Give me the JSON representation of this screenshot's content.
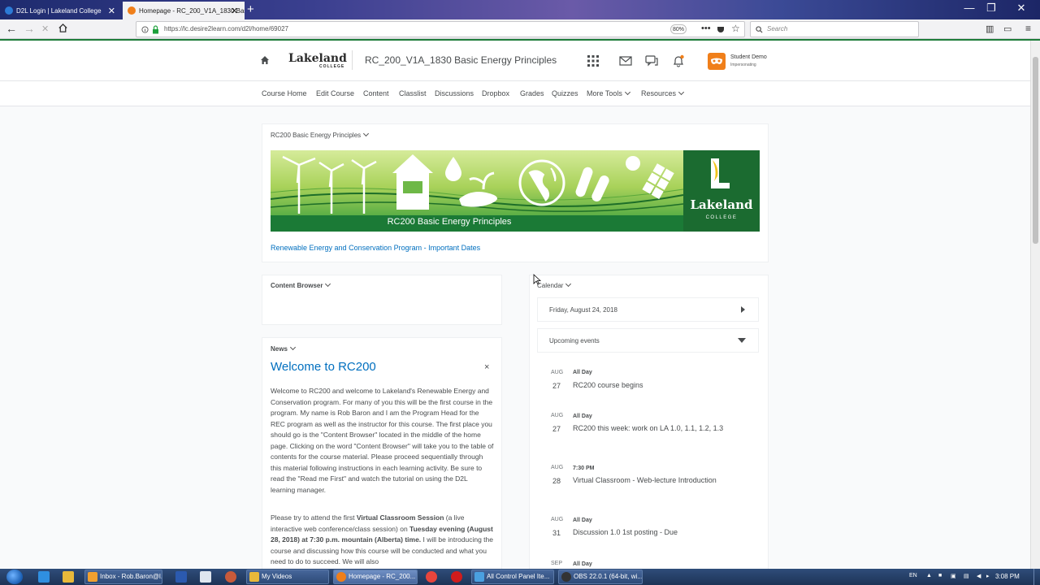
{
  "browser": {
    "tabs": [
      {
        "label": "D2L Login | Lakeland College",
        "active": false
      },
      {
        "label": "Homepage - RC_200_V1A_1830 Basic",
        "active": true
      }
    ],
    "new_tab": "+",
    "url": "https://lc.desire2learn.com/d2l/home/69027",
    "zoom": "80%",
    "search_placeholder": "Search",
    "window_controls": {
      "minimize": "—",
      "maximize": "❐",
      "close": "✕"
    }
  },
  "header": {
    "logo_main": "Lakeland",
    "logo_sub": "COLLEGE",
    "course_title": "RC_200_V1A_1830 Basic Energy Principles",
    "user_name": "Student Demo",
    "user_role": "Impersonating"
  },
  "course_nav": [
    {
      "label": "Course Home",
      "dropdown": false
    },
    {
      "label": "Edit Course",
      "dropdown": false
    },
    {
      "label": "Content",
      "dropdown": false
    },
    {
      "label": "Classlist",
      "dropdown": false
    },
    {
      "label": "Discussions",
      "dropdown": false
    },
    {
      "label": "Dropbox",
      "dropdown": false
    },
    {
      "label": "Grades",
      "dropdown": false
    },
    {
      "label": "Quizzes",
      "dropdown": false
    },
    {
      "label": "More Tools",
      "dropdown": true
    },
    {
      "label": "Resources",
      "dropdown": true
    }
  ],
  "course_widget": {
    "title": "RC200 Basic Energy Principles",
    "banner_caption": "RC200 Basic Energy Principles",
    "banner_logo": "Lakeland",
    "banner_logo_sub": "COLLEGE",
    "link": "Renewable Energy and Conservation Program - Important Dates"
  },
  "content_browser": {
    "title": "Content Browser"
  },
  "news": {
    "title": "News",
    "heading": "Welcome to RC200",
    "close": "×",
    "para1": "Welcome to RC200 and welcome to Lakeland's Renewable Energy and Conservation program.  For many of you this will be the first course in the program.  My name is Rob Baron and I am the Program Head for the REC program as well as the instructor for this course. The first place you should go is the \"Content Browser\" located in the middle of the home page.  Clicking on the word \"Content Browser\" will take you to the table of contents for the course material.  Please proceed sequentially through this material following instructions in each learning activity.  Be sure to read the \"Read me First\" and watch the tutorial on using the D2L learning manager.",
    "para2_a": "Please try to attend the first ",
    "para2_b": "Virtual Classroom Session",
    "para2_c": " (a live interactive web conference/class session) on ",
    "para2_d": "Tuesday evening (August 28, 2018) at 7:30 p.m. mountain (Alberta) time.",
    "para2_e": " I will be introducing the course and discussing how this course will be conducted and what you need to do to succeed.  We will also"
  },
  "calendar": {
    "title": "Calendar",
    "date": "Friday, August 24, 2018",
    "upcoming_label": "Upcoming events",
    "events": [
      {
        "month": "AUG",
        "day": "27",
        "time": "All Day",
        "title": "RC200 course begins"
      },
      {
        "month": "AUG",
        "day": "27",
        "time": "All Day",
        "title": "RC200 this week: work on LA 1.0, 1.1, 1.2, 1.3"
      },
      {
        "month": "AUG",
        "day": "28",
        "time": "7:30 PM",
        "title": "Virtual Classroom - Web-lecture Introduction"
      },
      {
        "month": "AUG",
        "day": "31",
        "time": "All Day",
        "title": "Discussion 1.0 1st posting - Due"
      },
      {
        "month": "SEP",
        "day": "",
        "time": "All Day",
        "title": ""
      }
    ]
  },
  "taskbar": {
    "buttons": [
      {
        "label": "Inbox - Rob.Baron@l...",
        "active": false
      },
      {
        "label": "My Videos",
        "active": false
      },
      {
        "label": "Homepage - RC_200...",
        "active": true
      },
      {
        "label": "All Control Panel Ite...",
        "active": false
      },
      {
        "label": "OBS 22.0.1 (64-bit, wi...",
        "active": false
      }
    ],
    "language": "EN",
    "clock": "3:08 PM"
  },
  "colors": {
    "accent_link": "#006fbf",
    "brand_green": "#1e7d3a",
    "avatar_orange": "#f07f1a"
  }
}
